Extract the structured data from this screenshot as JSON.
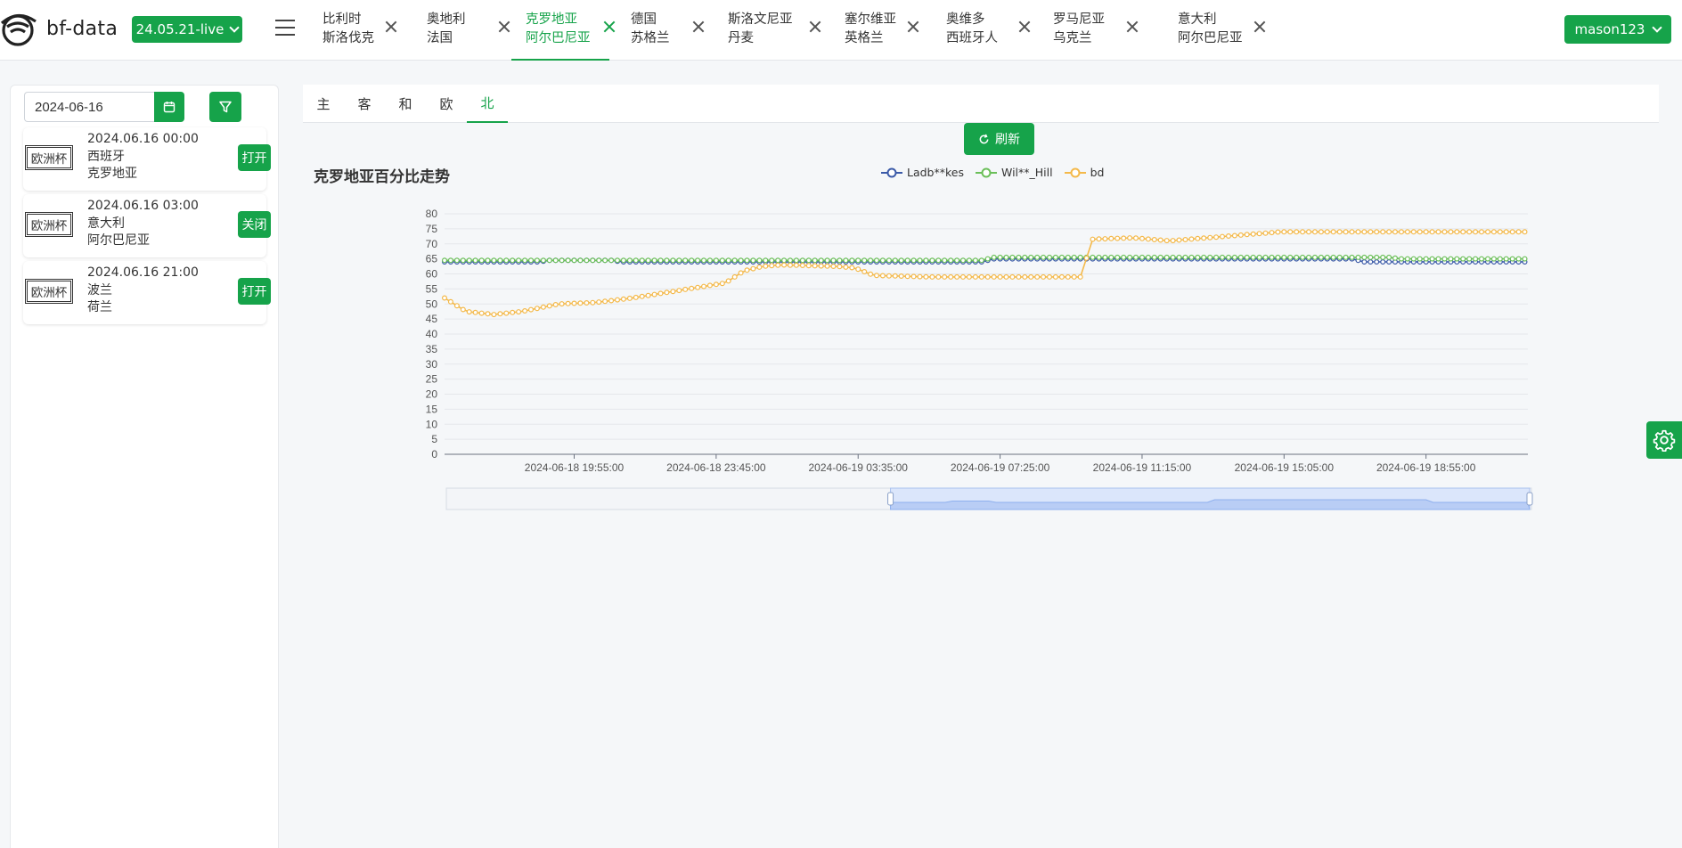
{
  "app": {
    "name": "bf-data",
    "version": "24.05.21-live",
    "user": "mason123"
  },
  "colors": {
    "accent": "#16a34a",
    "series1": "#3b5aa8",
    "series2": "#6bbf59",
    "series3": "#f4b94a"
  },
  "match_tabs": [
    {
      "home": "比利时",
      "away": "斯洛伐克",
      "active": false
    },
    {
      "home": "奥地利",
      "away": "法国",
      "active": false
    },
    {
      "home": "克罗地亚",
      "away": "阿尔巴尼亚",
      "active": true
    },
    {
      "home": "德国",
      "away": "苏格兰",
      "active": false
    },
    {
      "home": "斯洛文尼亚",
      "away": "丹麦",
      "active": false
    },
    {
      "home": "塞尔维亚",
      "away": "英格兰",
      "active": false
    },
    {
      "home": "奥维多",
      "away": "西班牙人",
      "active": false
    },
    {
      "home": "罗马尼亚",
      "away": "乌克兰",
      "active": false
    },
    {
      "home": "意大利",
      "away": "阿尔巴尼亚",
      "active": false
    }
  ],
  "sidebar": {
    "date_value": "2024-06-16",
    "matches": [
      {
        "league": "欧洲杯",
        "time": "2024.06.16 00:00",
        "home": "西班牙",
        "away": "克罗地亚",
        "action": "打开"
      },
      {
        "league": "欧洲杯",
        "time": "2024.06.16 03:00",
        "home": "意大利",
        "away": "阿尔巴尼亚",
        "action": "关闭"
      },
      {
        "league": "欧洲杯",
        "time": "2024.06.16 21:00",
        "home": "波兰",
        "away": "荷兰",
        "action": "打开"
      }
    ]
  },
  "subtabs": [
    {
      "label": "主",
      "active": false
    },
    {
      "label": "客",
      "active": false
    },
    {
      "label": "和",
      "active": false
    },
    {
      "label": "欧",
      "active": false
    },
    {
      "label": "北",
      "active": true
    }
  ],
  "refresh_label": "刷新",
  "chart_data": {
    "type": "line",
    "title": "克罗地亚百分比走势",
    "ylim": [
      0,
      80
    ],
    "yticks": [
      0,
      5,
      10,
      15,
      20,
      25,
      30,
      35,
      40,
      45,
      50,
      55,
      60,
      65,
      70,
      75,
      80
    ],
    "grid": true,
    "legend_position": "top-center",
    "x_tick_labels": [
      "2024-06-18 19:55:00",
      "2024-06-18 23:45:00",
      "2024-06-19 03:35:00",
      "2024-06-19 07:25:00",
      "2024-06-19 11:15:00",
      "2024-06-19 15:05:00",
      "2024-06-19 18:55:00"
    ],
    "x_range": [
      "2024-06-18 16:25:00",
      "2024-06-19 21:40:00"
    ],
    "x_tick_times": [
      "2024-06-18 19:55:00",
      "2024-06-18 23:45:00",
      "2024-06-19 03:35:00",
      "2024-06-19 07:25:00",
      "2024-06-19 11:15:00",
      "2024-06-19 15:05:00",
      "2024-06-19 18:55:00"
    ],
    "series": [
      {
        "name": "Ladb**kes",
        "points": [
          [
            "2024-06-18 16:25:00",
            64
          ],
          [
            "2024-06-18 19:00:00",
            64
          ],
          [
            "2024-06-18 19:10:00",
            64.5
          ],
          [
            "2024-06-18 21:00:00",
            64.5
          ],
          [
            "2024-06-18 21:10:00",
            64
          ],
          [
            "2024-06-19 07:00:00",
            64
          ],
          [
            "2024-06-19 07:10:00",
            65
          ],
          [
            "2024-06-19 17:00:00",
            65
          ],
          [
            "2024-06-19 17:10:00",
            64
          ],
          [
            "2024-06-19 21:40:00",
            64
          ]
        ]
      },
      {
        "name": "Wil**_Hill",
        "points": [
          [
            "2024-06-18 16:25:00",
            64.5
          ],
          [
            "2024-06-19 07:00:00",
            64.5
          ],
          [
            "2024-06-19 07:10:00",
            65.5
          ],
          [
            "2024-06-19 18:00:00",
            65.5
          ],
          [
            "2024-06-19 18:10:00",
            65
          ],
          [
            "2024-06-19 21:40:00",
            65
          ]
        ]
      },
      {
        "name": "bd",
        "points": [
          [
            "2024-06-18 16:25:00",
            52
          ],
          [
            "2024-06-18 17:00:00",
            47.5
          ],
          [
            "2024-06-18 17:45:00",
            46.5
          ],
          [
            "2024-06-18 18:30:00",
            47.5
          ],
          [
            "2024-06-18 19:30:00",
            50
          ],
          [
            "2024-06-18 20:30:00",
            50.5
          ],
          [
            "2024-06-18 21:30:00",
            52
          ],
          [
            "2024-06-18 22:30:00",
            54
          ],
          [
            "2024-06-18 23:30:00",
            56
          ],
          [
            "2024-06-19 00:00:00",
            57
          ],
          [
            "2024-06-19 00:30:00",
            61
          ],
          [
            "2024-06-19 01:00:00",
            62.5
          ],
          [
            "2024-06-19 01:30:00",
            63
          ],
          [
            "2024-06-19 03:00:00",
            62.5
          ],
          [
            "2024-06-19 03:30:00",
            62
          ],
          [
            "2024-06-19 04:00:00",
            59.5
          ],
          [
            "2024-06-19 05:30:00",
            59
          ],
          [
            "2024-06-19 09:40:00",
            59
          ],
          [
            "2024-06-19 09:50:00",
            71.5
          ],
          [
            "2024-06-19 11:00:00",
            72
          ],
          [
            "2024-06-19 12:00:00",
            71
          ],
          [
            "2024-06-19 13:00:00",
            72
          ],
          [
            "2024-06-19 14:00:00",
            73
          ],
          [
            "2024-06-19 15:00:00",
            74
          ],
          [
            "2024-06-19 21:40:00",
            74
          ]
        ]
      }
    ],
    "zoom_window": [
      0.41,
      1.0
    ]
  }
}
